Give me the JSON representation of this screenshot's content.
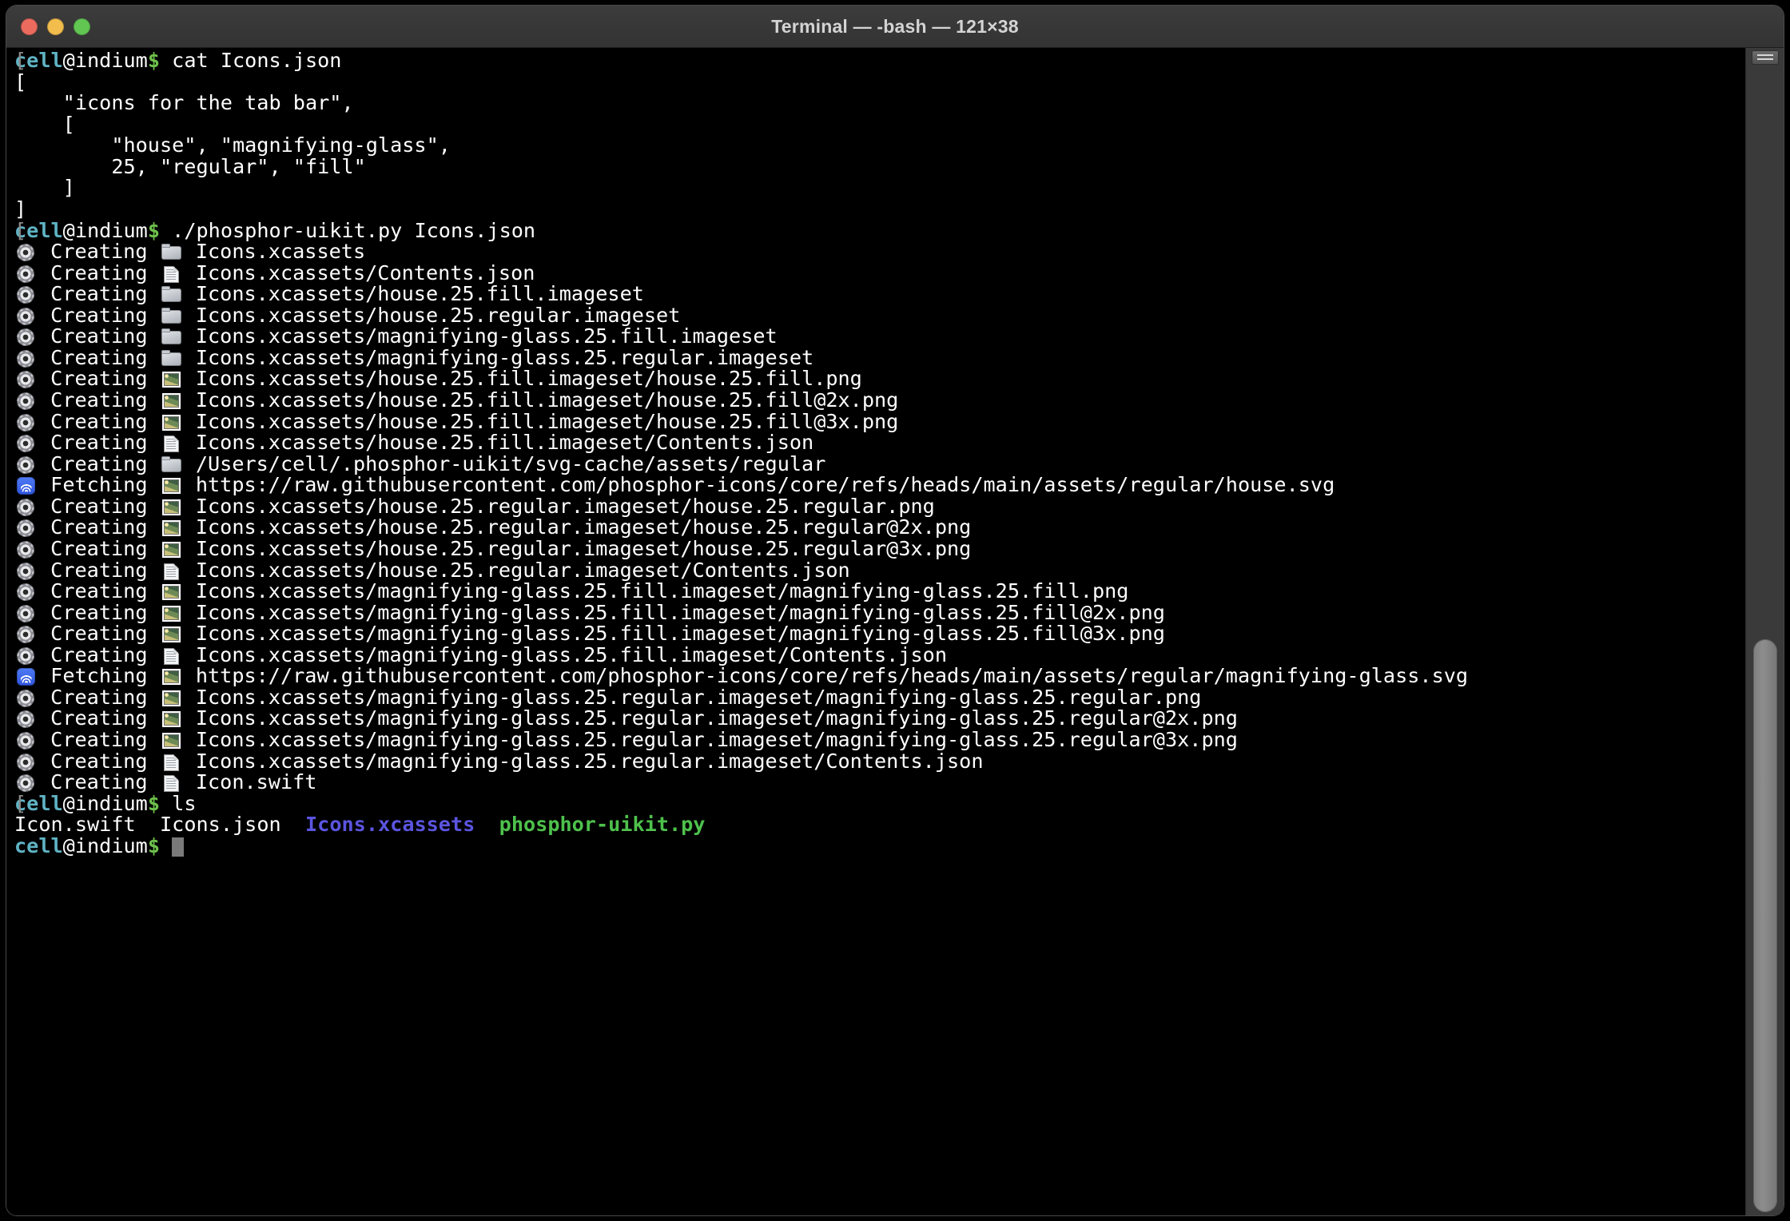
{
  "window": {
    "title": "Terminal — -bash — 121×38",
    "traffic_lights": [
      {
        "name": "close",
        "color": "#ec6b5f"
      },
      {
        "name": "minimize",
        "color": "#f2bd4d"
      },
      {
        "name": "zoom",
        "color": "#62c653"
      }
    ]
  },
  "colors": {
    "background": "#000000",
    "foreground": "#ffffff",
    "prompt_user": "#5fb3c4",
    "prompt_dollar": "#6ec14c",
    "directory": "#5b55e0",
    "executable": "#4ec14c",
    "titlebar": "#363636",
    "scrollbar_track": "#3a3a3a",
    "scrollbar_thumb": "#8d8d8d"
  },
  "prompt": {
    "user": "cell",
    "host": "@indium",
    "symbol": "$"
  },
  "labels": {
    "creating": "Creating",
    "fetching": "Fetching",
    "mark": "[",
    "edge_mark": "]"
  },
  "commands": {
    "cat": "cat Icons.json",
    "run": "./phosphor-uikit.py Icons.json",
    "ls": "ls"
  },
  "json_file_lines": [
    "[",
    "    \"icons for the tab bar\",",
    "    [",
    "        \"house\", \"magnifying-glass\",",
    "        25, \"regular\", \"fill\"",
    "    ]",
    "]"
  ],
  "output_lines": [
    {
      "verb": "Creating",
      "icon": "folder",
      "path": "Icons.xcassets"
    },
    {
      "verb": "Creating",
      "icon": "page",
      "path": "Icons.xcassets/Contents.json"
    },
    {
      "verb": "Creating",
      "icon": "folder",
      "path": "Icons.xcassets/house.25.fill.imageset"
    },
    {
      "verb": "Creating",
      "icon": "folder",
      "path": "Icons.xcassets/house.25.regular.imageset"
    },
    {
      "verb": "Creating",
      "icon": "folder",
      "path": "Icons.xcassets/magnifying-glass.25.fill.imageset"
    },
    {
      "verb": "Creating",
      "icon": "folder",
      "path": "Icons.xcassets/magnifying-glass.25.regular.imageset"
    },
    {
      "verb": "Creating",
      "icon": "image",
      "path": "Icons.xcassets/house.25.fill.imageset/house.25.fill.png"
    },
    {
      "verb": "Creating",
      "icon": "image",
      "path": "Icons.xcassets/house.25.fill.imageset/house.25.fill@2x.png"
    },
    {
      "verb": "Creating",
      "icon": "image",
      "path": "Icons.xcassets/house.25.fill.imageset/house.25.fill@3x.png"
    },
    {
      "verb": "Creating",
      "icon": "page",
      "path": "Icons.xcassets/house.25.fill.imageset/Contents.json"
    },
    {
      "verb": "Creating",
      "icon": "folder",
      "path": "/Users/cell/.phosphor-uikit/svg-cache/assets/regular"
    },
    {
      "verb": "Fetching",
      "icon": "image",
      "path": "https://raw.githubusercontent.com/phosphor-icons/core/refs/heads/main/assets/regular/house.svg"
    },
    {
      "verb": "Creating",
      "icon": "image",
      "path": "Icons.xcassets/house.25.regular.imageset/house.25.regular.png"
    },
    {
      "verb": "Creating",
      "icon": "image",
      "path": "Icons.xcassets/house.25.regular.imageset/house.25.regular@2x.png"
    },
    {
      "verb": "Creating",
      "icon": "image",
      "path": "Icons.xcassets/house.25.regular.imageset/house.25.regular@3x.png"
    },
    {
      "verb": "Creating",
      "icon": "page",
      "path": "Icons.xcassets/house.25.regular.imageset/Contents.json"
    },
    {
      "verb": "Creating",
      "icon": "image",
      "path": "Icons.xcassets/magnifying-glass.25.fill.imageset/magnifying-glass.25.fill.png"
    },
    {
      "verb": "Creating",
      "icon": "image",
      "path": "Icons.xcassets/magnifying-glass.25.fill.imageset/magnifying-glass.25.fill@2x.png"
    },
    {
      "verb": "Creating",
      "icon": "image",
      "path": "Icons.xcassets/magnifying-glass.25.fill.imageset/magnifying-glass.25.fill@3x.png"
    },
    {
      "verb": "Creating",
      "icon": "page",
      "path": "Icons.xcassets/magnifying-glass.25.fill.imageset/Contents.json"
    },
    {
      "verb": "Fetching",
      "icon": "image",
      "path": "https://raw.githubusercontent.com/phosphor-icons/core/refs/heads/main/assets/regular/magnifying-glass.svg"
    },
    {
      "verb": "Creating",
      "icon": "image",
      "path": "Icons.xcassets/magnifying-glass.25.regular.imageset/magnifying-glass.25.regular.png"
    },
    {
      "verb": "Creating",
      "icon": "image",
      "path": "Icons.xcassets/magnifying-glass.25.regular.imageset/magnifying-glass.25.regular@2x.png"
    },
    {
      "verb": "Creating",
      "icon": "image",
      "path": "Icons.xcassets/magnifying-glass.25.regular.imageset/magnifying-glass.25.regular@3x.png"
    },
    {
      "verb": "Creating",
      "icon": "page",
      "path": "Icons.xcassets/magnifying-glass.25.regular.imageset/Contents.json"
    },
    {
      "verb": "Creating",
      "icon": "page",
      "path": "Icon.swift"
    }
  ],
  "ls_output": [
    {
      "name": "Icon.swift",
      "kind": "file"
    },
    {
      "name": "Icons.json",
      "kind": "file"
    },
    {
      "name": "Icons.xcassets",
      "kind": "directory"
    },
    {
      "name": "phosphor-uikit.py",
      "kind": "executable"
    }
  ],
  "scrollbar": {
    "top_button_icon": "scroll-lines-icon",
    "thumb_position": "bottom"
  }
}
